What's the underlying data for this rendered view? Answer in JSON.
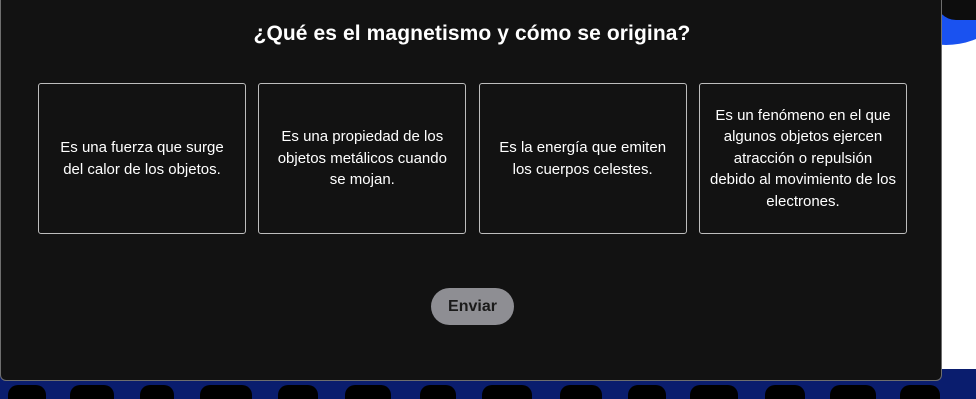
{
  "quiz": {
    "question": "¿Qué es el magnetismo y cómo se origina?",
    "options": [
      "Es una fuerza que surge del calor de los objetos.",
      "Es una propiedad de los objetos metálicos cuando se mojan.",
      "Es la energía que emiten los cuerpos celestes.",
      "Es un fenómeno en el que algunos objetos ejercen atracción o repulsión debido al movimiento de los electrones."
    ],
    "submit_label": "Enviar"
  },
  "colors": {
    "card_background": "#121212",
    "option_border": "#bdbdbd",
    "button_background": "#8e8e93",
    "accent_blue": "#1a52f0",
    "band_blue": "#0a1d6e"
  }
}
